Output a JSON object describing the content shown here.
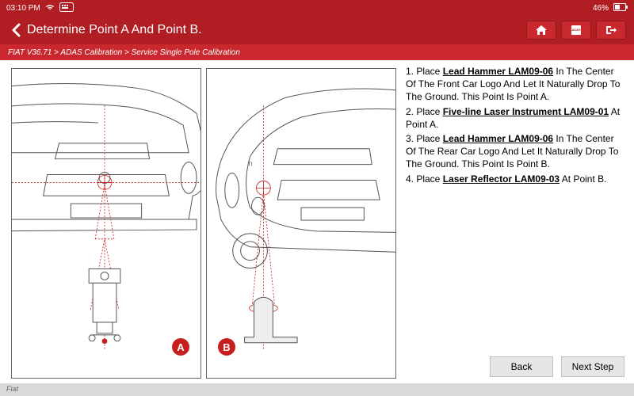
{
  "statusbar": {
    "time": "03:10 PM",
    "battery": "46%"
  },
  "title": "Determine Point A And Point B.",
  "breadcrumb": "FIAT V36.71 > ADAS Calibration > Service Single Pole Calibration",
  "instructions": {
    "s1a": "1. Place ",
    "s1tool": "Lead Hammer LAM09-06",
    "s1b": " In The Center Of The Front Car Logo And Let It Naturally Drop To The Ground. This Point Is Point A.",
    "s2a": "2. Place ",
    "s2tool": "Five-line Laser Instrument LAM09-01",
    "s2b": " At Point A.",
    "s3a": "3. Place ",
    "s3tool": "Lead Hammer LAM09-06",
    "s3b": " In The Center Of The Rear Car Logo And Let It Naturally Drop To The Ground. This Point Is Point B.",
    "s4a": "4. Place ",
    "s4tool": "Laser Reflector LAM09-03",
    "s4b": " At Point B."
  },
  "badges": {
    "a": "A",
    "b": "B"
  },
  "buttons": {
    "back": "Back",
    "next": "Next Step"
  },
  "footer": "Fiat"
}
